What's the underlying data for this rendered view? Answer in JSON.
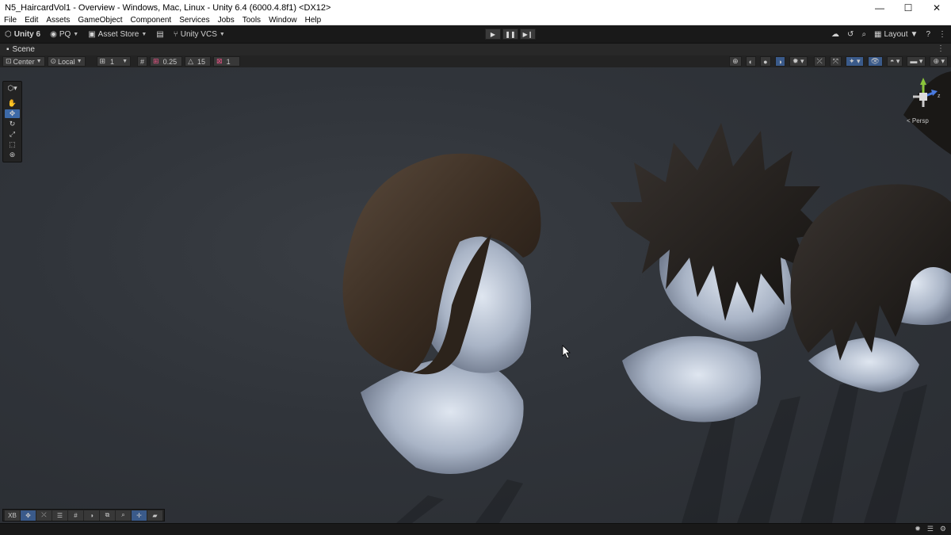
{
  "window": {
    "title": "N5_HaircardVol1 - Overview - Windows, Mac, Linux - Unity 6.4 (6000.4.8f1) <DX12>",
    "controls": [
      "—",
      "☐",
      "✕"
    ]
  },
  "menu": [
    "File",
    "Edit",
    "Assets",
    "GameObject",
    "Component",
    "Services",
    "Jobs",
    "Tools",
    "Window",
    "Help"
  ],
  "toolbar": {
    "unity_label": "Unity 6",
    "account_label": "PQ",
    "asset_store_label": "Asset Store",
    "vcs_label": "Unity VCS",
    "layout_label": "Layout"
  },
  "scene_tab": {
    "label": "Scene"
  },
  "scene_toolbar": {
    "pivot_label": "Center",
    "space_label": "Local",
    "grid_value": "1",
    "snap_value": "0.25",
    "angle_value": "15",
    "scale_value": "1"
  },
  "gizmo": {
    "axis_z": "z",
    "projection_label": "< Persp"
  },
  "bottom_overlay": {
    "xr_label": "XB"
  },
  "colors": {
    "active_tool": "#3d6aa8",
    "background": "#191919",
    "viewport": "#30343a"
  }
}
